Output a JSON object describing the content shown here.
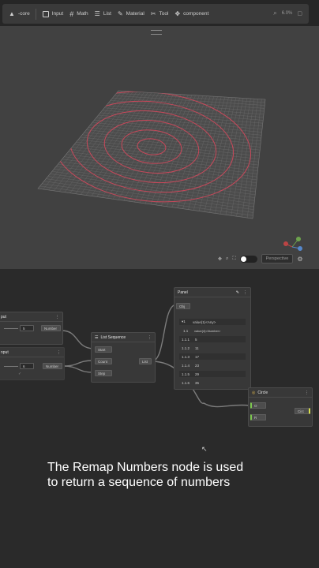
{
  "toolbar": {
    "items": [
      {
        "label": "-core",
        "icon": "core-icon"
      },
      {
        "label": "Input",
        "icon": "input-icon"
      },
      {
        "label": "Math",
        "icon": "math-icon"
      },
      {
        "label": "List",
        "icon": "list-icon"
      },
      {
        "label": "Material",
        "icon": "material-icon"
      },
      {
        "label": "Tool",
        "icon": "tool-icon"
      },
      {
        "label": "component",
        "icon": "component-icon"
      }
    ],
    "zoom": "6.0%"
  },
  "viewport": {
    "mode": "Perspective",
    "grid_color": "#6b6b6b",
    "circle_color": "#c8485a"
  },
  "nodes": {
    "input1": {
      "title": "put",
      "value": "5",
      "output": "Number"
    },
    "input2": {
      "title": "nput",
      "value": "6",
      "output": "Number"
    },
    "list_sequence": {
      "title": "List Sequence",
      "inputs": [
        "Start",
        "Count",
        "Step"
      ],
      "output": "List"
    },
    "panel": {
      "title": "Panel",
      "obj": "Obj",
      "header": "value(1)<Any>",
      "subheader_idx": "1.1",
      "subheader": "value(4)<Number>",
      "rows": [
        {
          "idx": "1.1.1",
          "val": "5"
        },
        {
          "idx": "1.1.2",
          "val": "11"
        },
        {
          "idx": "1.1.3",
          "val": "17"
        },
        {
          "idx": "1.1.4",
          "val": "23"
        },
        {
          "idx": "1.1.5",
          "val": "29"
        },
        {
          "idx": "1.1.6",
          "val": "35"
        }
      ]
    },
    "circle": {
      "title": "Circle",
      "inputs": [
        "O",
        "R"
      ],
      "output": "Circ"
    }
  },
  "caption": {
    "line1": "The Remap Numbers node is used",
    "line2": "to return a sequence of numbers"
  }
}
